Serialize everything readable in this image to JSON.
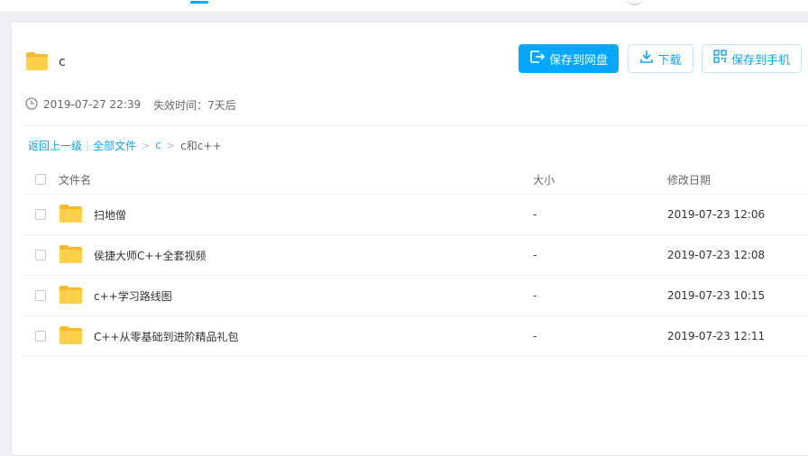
{
  "top": {},
  "share": {
    "name": "c",
    "date": "2019-07-27 22:39",
    "expire_label": "失效时间：",
    "expire_value": "7天后"
  },
  "actions": {
    "save_label": "保存到网盘",
    "download_label": "下载",
    "mobile_label": "保存到手机"
  },
  "breadcrumb": {
    "back": "返回上一级",
    "sep": "|",
    "all": "全部文件",
    "arrow": ">",
    "c": "c",
    "current": "c和c++"
  },
  "table": {
    "headers": {
      "name": "文件名",
      "size": "大小",
      "date": "修改日期"
    },
    "rows": [
      {
        "name": "扫地僧",
        "size": "-",
        "date": "2019-07-23 12:06"
      },
      {
        "name": "侯捷大师C++全套视频",
        "size": "-",
        "date": "2019-07-23 12:08"
      },
      {
        "name": "c++学习路线图",
        "size": "-",
        "date": "2019-07-23 10:15"
      },
      {
        "name": "C++从零基础到进阶精品礼包",
        "size": "-",
        "date": "2019-07-23 12:11"
      }
    ]
  },
  "colors": {
    "accent": "#06a7ff",
    "folder": "#ffd04a",
    "folder_tab": "#f5bb2c",
    "text": "#333333",
    "muted": "#666666",
    "border": "#f0f2f4"
  },
  "icons": {
    "folder": "folder-icon",
    "clock": "clock-icon",
    "save": "save-to-cloud-icon",
    "download": "download-icon",
    "mobile": "qr-phone-icon"
  }
}
